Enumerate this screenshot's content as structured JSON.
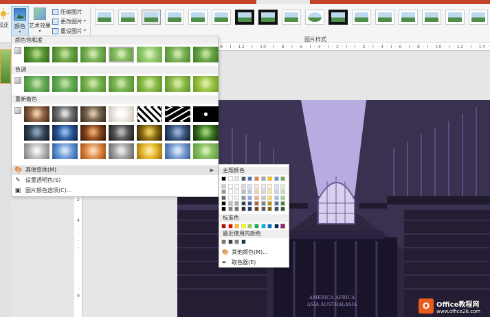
{
  "ribbon": {
    "correct_label": "校正",
    "color_label": "颜色",
    "art_label": "艺术效果",
    "compress_label": "压缩图片",
    "change_label": "更改图片",
    "reset_label": "重设图片",
    "styles_label": "图片样式"
  },
  "color_menu": {
    "saturation_header": "颜色饱和度",
    "tone_header": "色调",
    "recolor_header": "重新着色",
    "more_variants": "其他变体(M)",
    "set_transparent": "设置透明色(S)",
    "picture_color_options": "图片颜色选项(C)..."
  },
  "submenu": {
    "theme_colors": "主题颜色",
    "standard_colors": "标准色",
    "recent_colors": "最近使用的颜色",
    "more_colors": "其他颜色(M)...",
    "eyedropper": "取色器(E)",
    "theme_palette": [
      "#000000",
      "#ffffff",
      "#e7e6e6",
      "#44546a",
      "#4472c4",
      "#ed7d31",
      "#a5a5a5",
      "#ffc000",
      "#5b9bd5",
      "#70ad47"
    ],
    "standard_palette": [
      "#c00000",
      "#ff0000",
      "#ffc000",
      "#ffff00",
      "#92d050",
      "#00b050",
      "#00b0f0",
      "#0070c0",
      "#002060",
      "#7030a0"
    ],
    "recent_palette": [
      "#8c6e5a",
      "#404040",
      "#808080",
      "#1f3a4a"
    ]
  },
  "ruler": {
    "horizontal": "8 · I · 12 · I · 10 · I · 8 · I · 6 · I · 4 · I · 2 · I · I · 2 · I · 4 · I · 6 · I · 8 · I · 10 · I · 12 · I · 14 · I · 16 · I",
    "vertical": [
      "2",
      "·",
      "4",
      "·",
      "6",
      "·",
      "8",
      "·",
      "9"
    ]
  },
  "watermark": {
    "logo_letter": "O",
    "brand": "Office教程网",
    "url": "www.office26.com"
  },
  "slide_text": {
    "line1": "AMERICA   AFRICA",
    "line2": "ASIA   AUSTRALASIA"
  },
  "colors": {
    "accent": "#c5432b",
    "slide_tint": "#7b68a8"
  }
}
